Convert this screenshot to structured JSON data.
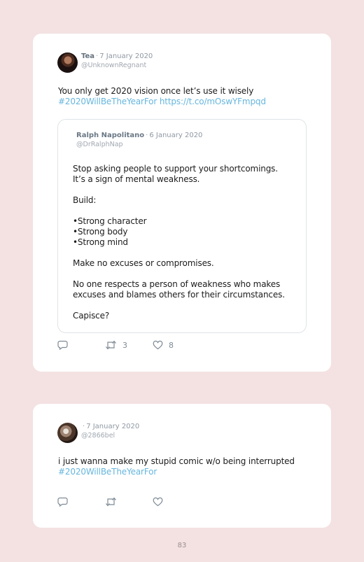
{
  "tweets": [
    {
      "author": "Tea",
      "date": "7 January 2020",
      "handle": "@UnknownRegnant",
      "text_line1": "You only get 2020 vision once let’s use it wisely",
      "hashtag": "#2020WillBeTheYearFor",
      "link": "https://t.co/mOswYFmpqd",
      "quote": {
        "author": "Ralph Napolitano",
        "date": "6 January 2020",
        "handle": "@DrRalphNap",
        "paragraphs": [
          "Stop asking people to support your shortcomings.",
          "It’s a sign of mental weakness.",
          "",
          "Build:",
          "",
          "•Strong character",
          "•Strong body",
          "•Strong mind",
          "",
          "Make no excuses or compromises.",
          "",
          "No one respects a person of weakness who makes",
          "excuses and blames others for their circumstances.",
          "",
          "Capisce?"
        ]
      },
      "retweets": "3",
      "likes": "8"
    },
    {
      "author": "",
      "date": "7 January 2020",
      "handle": "@2866bel",
      "text_line1": "i just wanna make my stupid comic w/o being interrupted",
      "hashtag": "#2020WillBeTheYearFor"
    }
  ],
  "icons": {
    "reply": "reply-icon",
    "retweet": "retweet-icon",
    "like": "heart-icon"
  },
  "colors": {
    "background": "#f4e1e2",
    "card": "#ffffff",
    "link": "#66b6de",
    "meta": "#8f98a3"
  },
  "page_number": "83"
}
